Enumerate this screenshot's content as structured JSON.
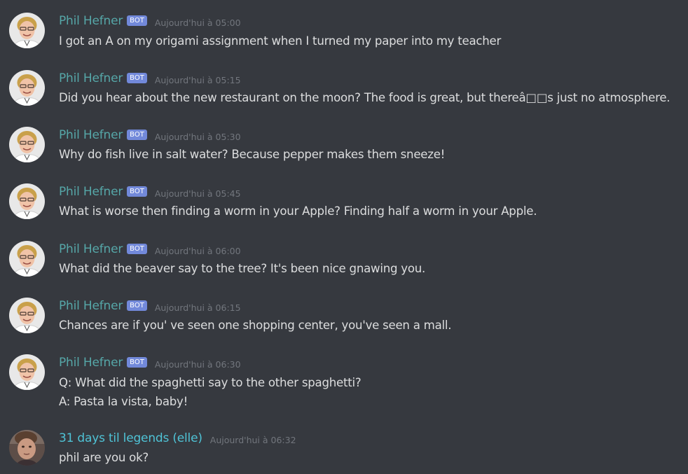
{
  "messages": [
    {
      "author": "Phil Hefner",
      "author_color": "#56a7a8",
      "bot_badge": "BOT",
      "timestamp": "Aujourd'hui à 05:00",
      "lines": [
        "I got an A on my origami assignment when I turned my paper into my teacher"
      ]
    },
    {
      "author": "Phil Hefner",
      "author_color": "#56a7a8",
      "bot_badge": "BOT",
      "timestamp": "Aujourd'hui à 05:15",
      "lines": [
        "Did you hear about the new restaurant on the moon? The food is great, but thereâ□□s just no atmosphere."
      ]
    },
    {
      "author": "Phil Hefner",
      "author_color": "#56a7a8",
      "bot_badge": "BOT",
      "timestamp": "Aujourd'hui à 05:30",
      "lines": [
        "Why do fish live in salt water? Because pepper makes them sneeze!"
      ]
    },
    {
      "author": "Phil Hefner",
      "author_color": "#56a7a8",
      "bot_badge": "BOT",
      "timestamp": "Aujourd'hui à 05:45",
      "lines": [
        "What is worse then finding a worm in your Apple? Finding half a worm in your Apple."
      ]
    },
    {
      "author": "Phil Hefner",
      "author_color": "#56a7a8",
      "bot_badge": "BOT",
      "timestamp": "Aujourd'hui à 06:00",
      "lines": [
        "What did the beaver say to the tree? It's been nice gnawing you."
      ]
    },
    {
      "author": "Phil Hefner",
      "author_color": "#56a7a8",
      "bot_badge": "BOT",
      "timestamp": "Aujourd'hui à 06:15",
      "lines": [
        "Chances are if you' ve seen one shopping center, you've seen a mall."
      ]
    },
    {
      "author": "Phil Hefner",
      "author_color": "#56a7a8",
      "bot_badge": "BOT",
      "timestamp": "Aujourd'hui à 06:30",
      "lines": [
        "Q: What did the spaghetti say to the other spaghetti?",
        "A: Pasta la vista, baby!"
      ]
    },
    {
      "author": "31 days til legends (elle)",
      "author_color": "#4fc3d6",
      "bot_badge": "",
      "timestamp": "Aujourd'hui à 06:32",
      "lines": [
        "phil are you ok?"
      ]
    }
  ],
  "colors": {
    "background": "#36393f",
    "message_text": "#dcddde",
    "timestamp": "#72767d",
    "bot_badge_bg": "#7289da"
  },
  "icons": {
    "bot_avatar": "avatar-phil-hefner-icon",
    "user_avatar": "avatar-user-icon"
  }
}
